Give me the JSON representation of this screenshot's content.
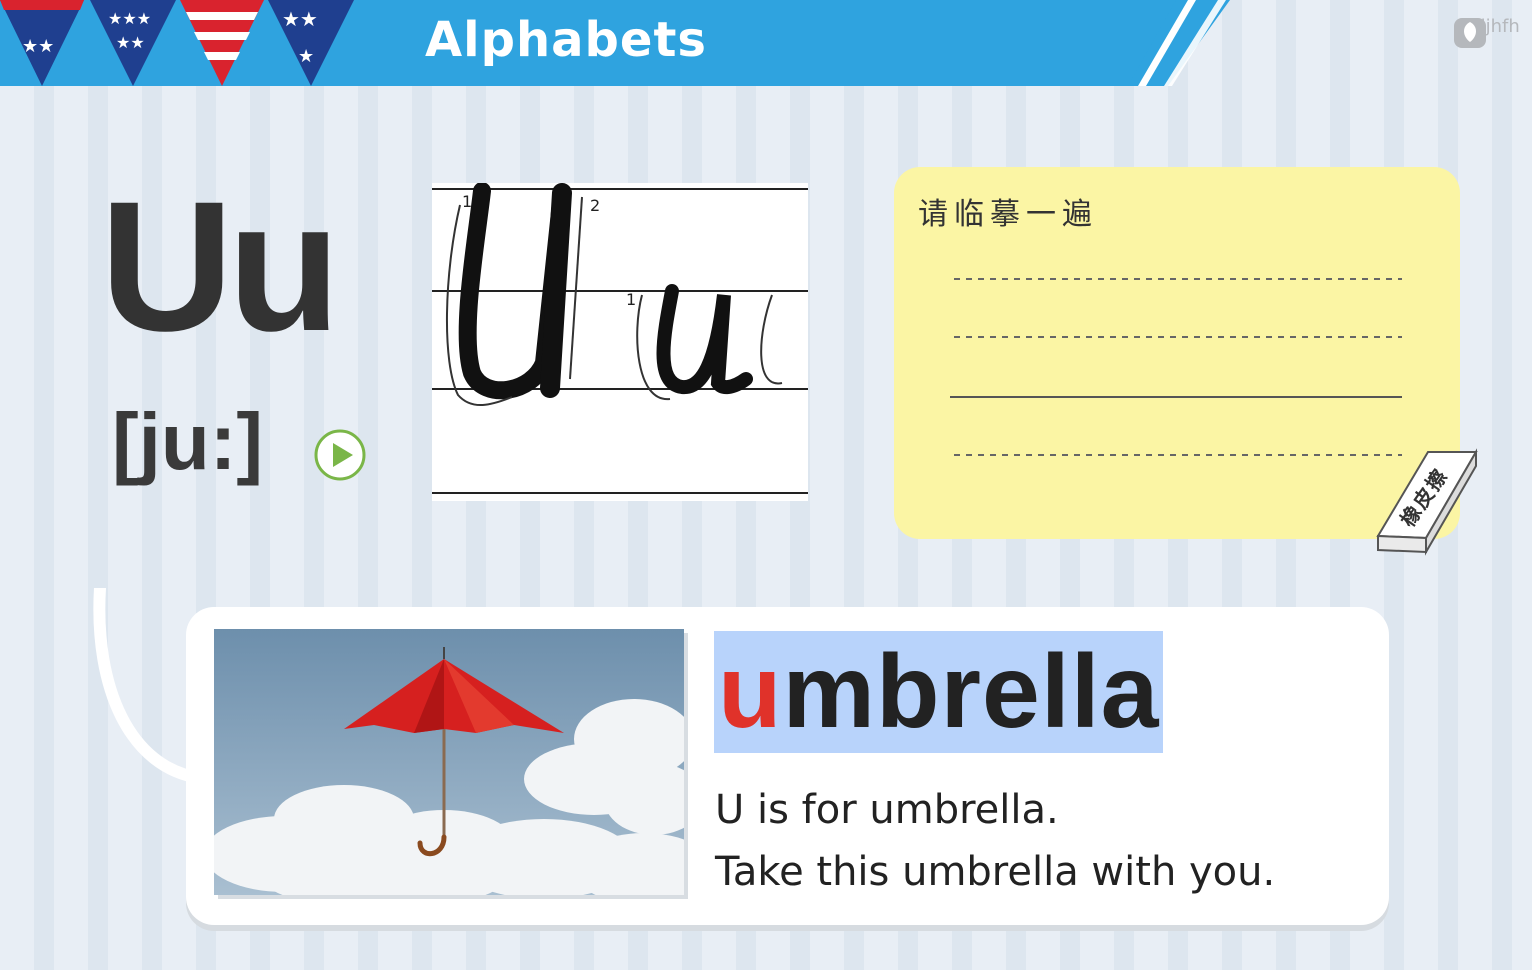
{
  "header": {
    "title": "Alphabets",
    "logo_text": "njllljhfh"
  },
  "letter": {
    "display": "Uu",
    "phonetic": "[ju:]"
  },
  "audio": {
    "icon": "play-icon"
  },
  "writing_card": {
    "title": "请临摹一遍",
    "eraser_label": "橡皮擦"
  },
  "word": {
    "first_letter": "u",
    "rest": "mbrella"
  },
  "sentences": [
    "U is for umbrella.",
    "Take this umbrella with you."
  ],
  "colors": {
    "header_blue": "#2fa3df",
    "note_yellow": "#fbf5a4",
    "word_highlight": "#b8d3fb",
    "first_letter_red": "#e0322a",
    "play_green": "#7ab648"
  }
}
